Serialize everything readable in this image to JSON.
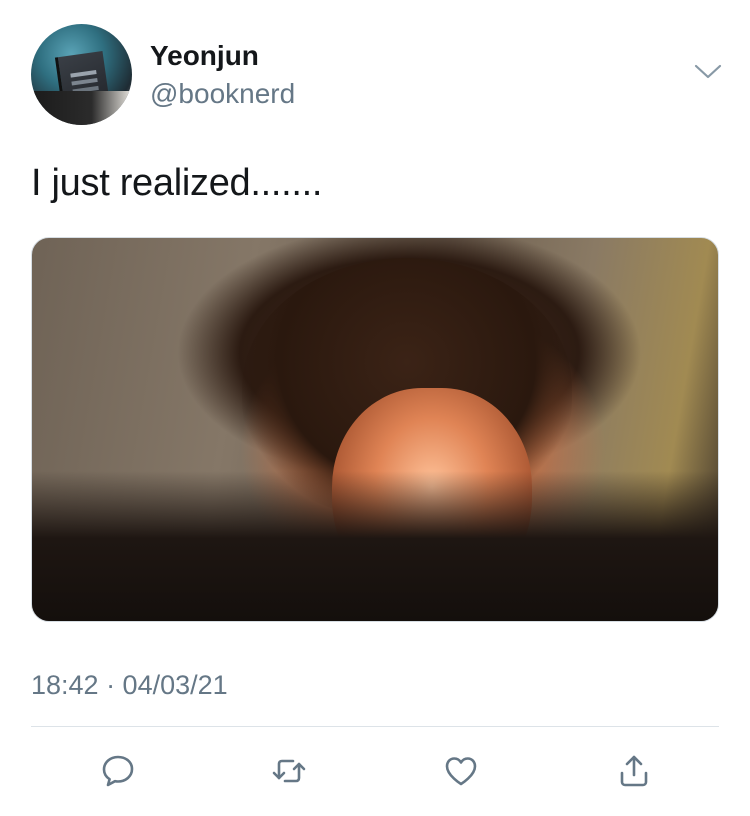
{
  "user": {
    "display_name": "Yeonjun",
    "handle": "@booknerd"
  },
  "tweet": {
    "text": "I just realized.......",
    "timestamp": "18:42 · 04/03/21"
  },
  "icons": {
    "menu": "chevron-down-icon",
    "reply": "reply-icon",
    "retweet": "retweet-icon",
    "like": "heart-icon",
    "share": "share-icon"
  },
  "colors": {
    "text_primary": "#14171a",
    "text_secondary": "#657786",
    "icon_gray": "#657786",
    "divider": "#dde3e8"
  }
}
